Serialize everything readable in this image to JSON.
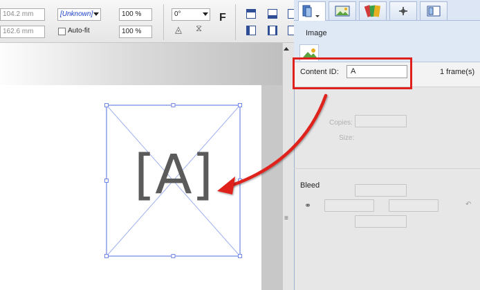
{
  "toolbar": {
    "x_value": "104.2 mm",
    "y_value": "162.6 mm",
    "font_value": "[Unknown]",
    "auto_fit_label": "Auto-fit",
    "scale_x": "100 %",
    "scale_y": "100 %",
    "rotation_value": "0°",
    "flip_letter": "F"
  },
  "panel": {
    "title": "Image",
    "content_id_label": "Content ID:",
    "content_id_value": "A",
    "frame_count": "1 frame(s)",
    "copies_label": "Copies:",
    "size_label": "Size:",
    "bleed_label": "Bleed"
  },
  "canvas": {
    "placeholder_text": "[A]"
  },
  "colors": {
    "annotation_red": "#e0201d",
    "frame_blue": "#6f86e6"
  }
}
